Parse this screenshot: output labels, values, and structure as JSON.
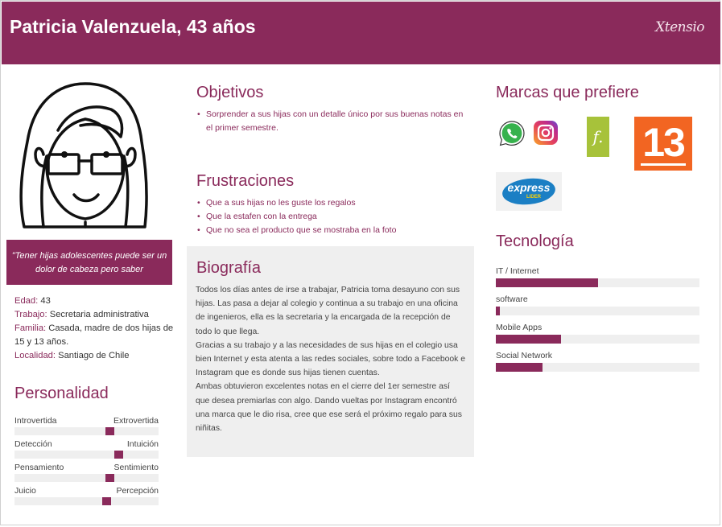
{
  "header": {
    "title": "Patricia Valenzuela, 43 años",
    "brand": "Xtensio"
  },
  "quote": "\"Tener hijas adolescentes puede ser un dolor de cabeza pero saber",
  "info": [
    {
      "label": "Edad:",
      "value": " 43"
    },
    {
      "label": "Trabajo:",
      "value": " Secretaria administrativa"
    },
    {
      "label": "Familia:",
      "value": " Casada, madre de dos hijas de 15 y 13 años."
    },
    {
      "label": "Localidad:",
      "value": " Santiago de Chile"
    }
  ],
  "personality": {
    "title": "Personalidad",
    "traits": [
      {
        "left": "Introvertida",
        "right": "Extrovertida",
        "value": 0.67
      },
      {
        "left": "Detección",
        "right": "Intuición",
        "value": 0.74
      },
      {
        "left": "Pensamiento",
        "right": "Sentimiento",
        "value": 0.67
      },
      {
        "left": "Juicio",
        "right": "Percepción",
        "value": 0.65
      }
    ]
  },
  "objectives": {
    "title": "Objetivos",
    "items": [
      "Sorprender a sus hijas con un detalle único por sus buenas notas en el primer semestre."
    ]
  },
  "frustrations": {
    "title": "Frustraciones",
    "items": [
      "Que a sus hijas no les guste los regalos",
      "Que la estafen con la entrega",
      "Que no sea el producto que se mostraba en la foto"
    ]
  },
  "bio": {
    "title": "Biografía",
    "paragraphs": [
      "Todos los días antes de irse a trabajar, Patricia toma desayuno con sus hijas. Las pasa a dejar al colegio y continua a su trabajo en una oficina de ingenieros, ella es la secretaria y la encargada de la recepción de todo lo que llega.",
      "Gracias a su trabajo y a las necesidades de sus hijas en el colegio usa bien Internet y esta atenta a las redes sociales, sobre todo a Facebook e Instagram que es donde sus hijas tienen cuentas.",
      "Ambas obtuvieron excelentes notas en el cierre del 1er semestre así que desea premiarlas con algo. Dando vueltas por Instagram encontró una marca que le dio risa, cree que ese será el próximo regalo para sus niñitas."
    ]
  },
  "brands": {
    "title": "Marcas que prefiere",
    "logos": [
      {
        "icon": "whatsapp-icon",
        "text": ""
      },
      {
        "icon": "instagram-icon",
        "text": ""
      },
      {
        "icon": "falabella-icon",
        "text": "f."
      },
      {
        "icon": "canal13-icon",
        "text": "13"
      },
      {
        "icon": "express-lider-icon",
        "text": "express",
        "sub": "LIDER"
      }
    ]
  },
  "technology": {
    "title": "Tecnología",
    "items": [
      {
        "label": "IT / Internet",
        "value": 0.5
      },
      {
        "label": "software",
        "value": 0.02
      },
      {
        "label": "Mobile Apps",
        "value": 0.32
      },
      {
        "label": "Social Network",
        "value": 0.23
      }
    ]
  },
  "colors": {
    "accent": "#8a2a5b",
    "panel": "#efefef"
  }
}
